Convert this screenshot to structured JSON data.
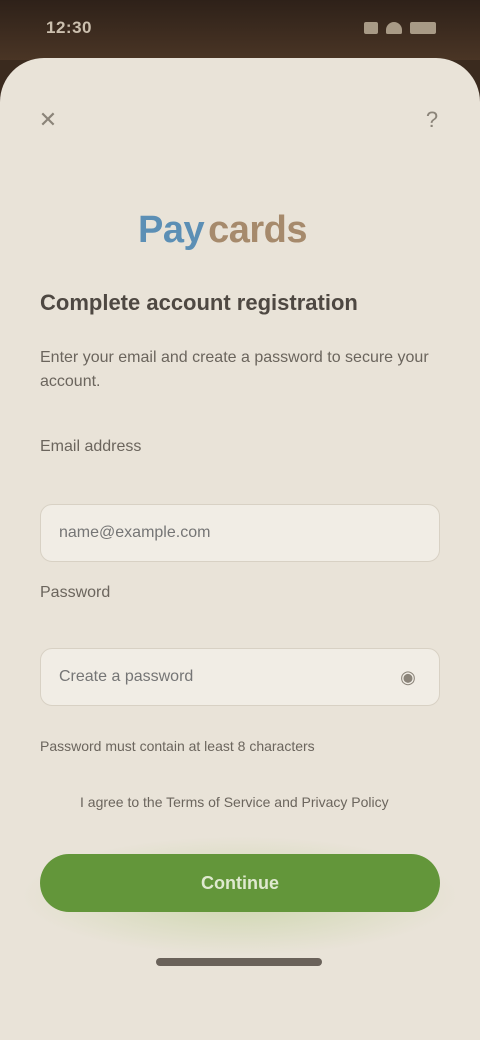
{
  "status_bar": {
    "time": "12:30"
  },
  "icons": {
    "close": "close-icon",
    "help": "help-icon",
    "eye": "eye-icon"
  },
  "brand": {
    "part_a": "Pay",
    "part_b": "cards"
  },
  "form": {
    "title": "Complete account registration",
    "subtitle": "Enter your email and create a password to secure your account.",
    "email_label": "Email address",
    "email_value": "",
    "email_placeholder": "name@example.com",
    "password_label": "Password",
    "password_value": "",
    "password_placeholder": "Create a password",
    "forgot_text": "Password must contain at least 8 characters",
    "remember_text": "I agree to the Terms of Service and Privacy Policy",
    "submit_label": "Continue"
  },
  "colors": {
    "accent": "#63963a",
    "background": "#e9e3d8",
    "brand_blue": "#5c8fb5",
    "brand_tan": "#a68a6c"
  }
}
